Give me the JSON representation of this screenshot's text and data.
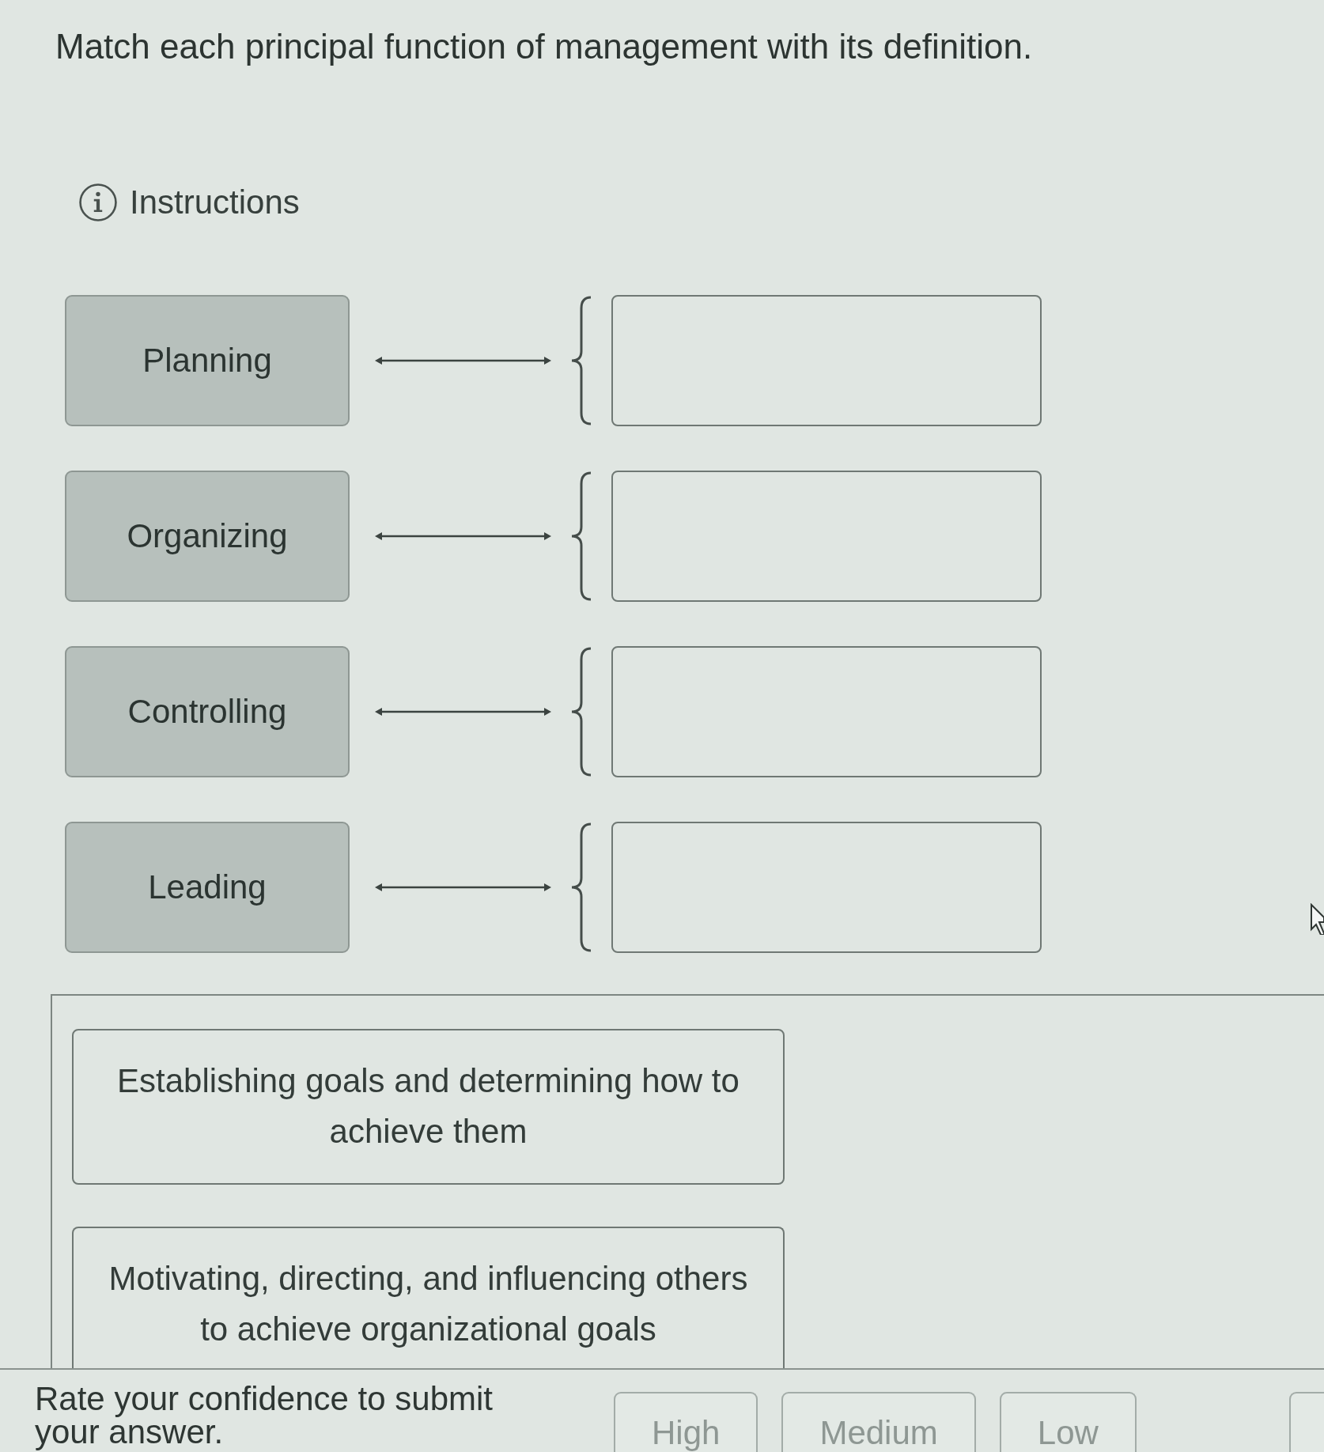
{
  "question": {
    "prompt": "Match each principal function of management with its definition."
  },
  "instructions": {
    "label": "Instructions"
  },
  "matching": {
    "rows": [
      {
        "term": "Planning"
      },
      {
        "term": "Organizing"
      },
      {
        "term": "Controlling"
      },
      {
        "term": "Leading"
      }
    ]
  },
  "choices": [
    {
      "text": "Establishing goals and determining how to achieve them"
    },
    {
      "text": "Motivating, directing, and influencing others to achieve organizational goals"
    }
  ],
  "confidence": {
    "prompt": "Rate your confidence to submit your answer.",
    "buttons": [
      {
        "label": "High",
        "disabled": true
      },
      {
        "label": "Medium",
        "disabled": true
      },
      {
        "label": "Low",
        "disabled": true
      },
      {
        "disabled": true
      }
    ]
  }
}
